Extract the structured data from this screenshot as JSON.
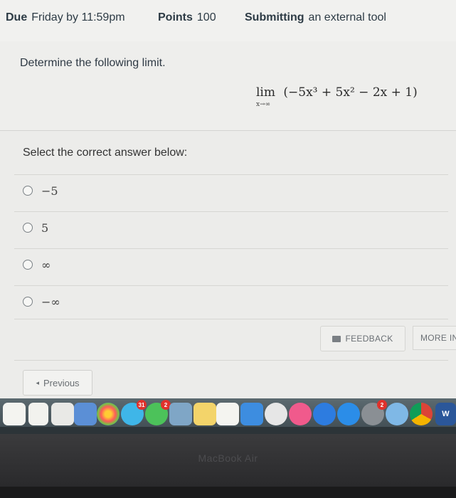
{
  "header": {
    "due_key": "Due",
    "due_value": "Friday by 11:59pm",
    "points_key": "Points",
    "points_value": "100",
    "submitting_key": "Submitting",
    "submitting_value": "an external tool"
  },
  "question": {
    "prompt": "Determine the following limit.",
    "limit_label": "lim",
    "limit_sub": "x→∞",
    "expression": "(−5x³ + 5x² − 2x + 1)"
  },
  "answers": {
    "instruction": "Select the correct answer below:",
    "options": [
      "−5",
      "5",
      "∞",
      "−∞"
    ]
  },
  "buttons": {
    "feedback": "FEEDBACK",
    "more": "MORE IN",
    "previous": "Previous"
  },
  "laptop": {
    "brand": "MacBook Air"
  },
  "dock": {
    "calendar_day": "31",
    "badge_2": "2"
  }
}
